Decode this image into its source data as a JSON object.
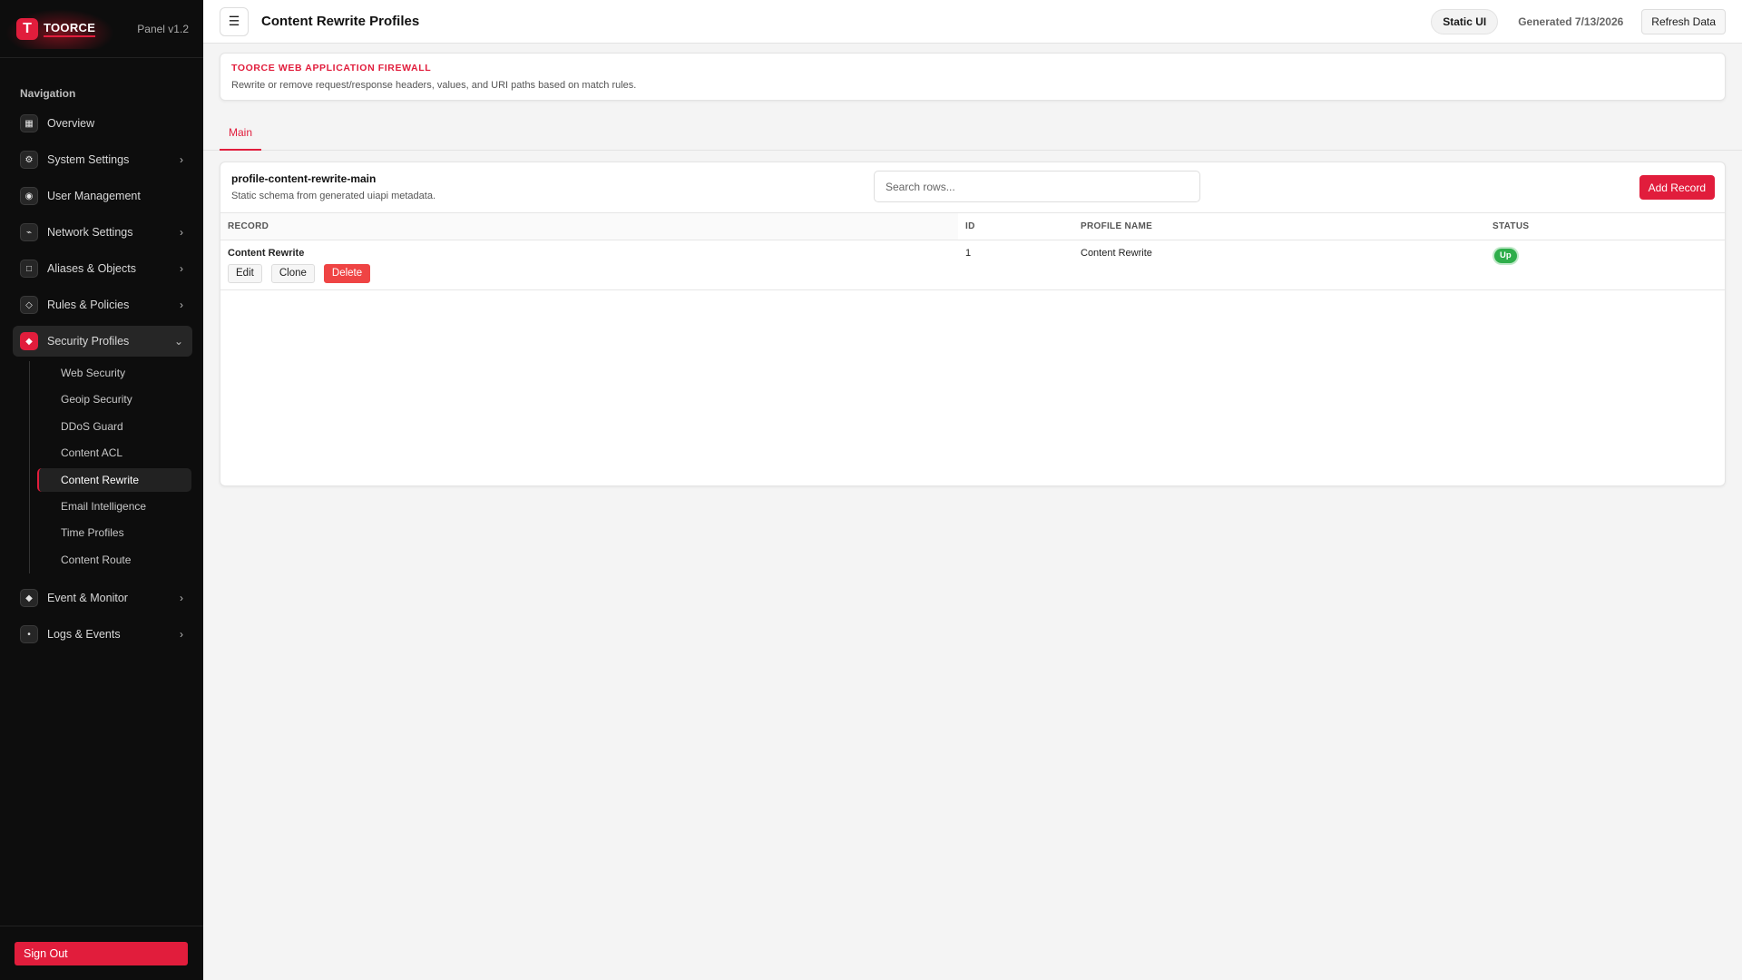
{
  "brand": {
    "name": "TOORCE",
    "logo_letter": "T",
    "version": "Panel v1.2"
  },
  "sidebar": {
    "heading": "Navigation",
    "items": [
      {
        "label": "Overview",
        "icon": "grid-icon",
        "glyph": "▦",
        "expandable": false
      },
      {
        "label": "System Settings",
        "icon": "gear-icon",
        "glyph": "⚙",
        "expandable": true
      },
      {
        "label": "User Management",
        "icon": "user-icon",
        "glyph": "◉",
        "expandable": false
      },
      {
        "label": "Network Settings",
        "icon": "network-icon",
        "glyph": "⌁",
        "expandable": true
      },
      {
        "label": "Aliases & Objects",
        "icon": "box-icon",
        "glyph": "□",
        "expandable": true
      },
      {
        "label": "Rules & Policies",
        "icon": "diamond-icon",
        "glyph": "◇",
        "expandable": true
      },
      {
        "label": "Security Profiles",
        "icon": "shield-icon",
        "glyph": "◆",
        "expandable": true,
        "open": true
      },
      {
        "label": "Event & Monitor",
        "icon": "monitor-icon",
        "glyph": "◆",
        "expandable": true
      },
      {
        "label": "Logs & Events",
        "icon": "log-icon",
        "glyph": "•",
        "expandable": true
      }
    ],
    "sub_items": [
      "Web Security",
      "Geoip Security",
      "DDoS Guard",
      "Content ACL",
      "Content Rewrite",
      "Email Intelligence",
      "Time Profiles",
      "Content Route"
    ],
    "active_sub": "Content Rewrite",
    "sign_out": "Sign Out"
  },
  "topbar": {
    "menu_glyph": "☰",
    "title": "Content Rewrite Profiles",
    "mode_pill": "Static UI",
    "generated": "Generated 7/13/2026",
    "refresh": "Refresh Data"
  },
  "banner": {
    "kicker": "TOORCE WEB APPLICATION FIREWALL",
    "description": "Rewrite or remove request/response headers, values, and URI paths based on match rules."
  },
  "tabs": [
    {
      "label": "Main",
      "active": true
    }
  ],
  "table_card": {
    "title": "profile-content-rewrite-main",
    "subtitle": "Static schema from generated uiapi metadata.",
    "search_placeholder": "Search rows...",
    "add_label": "Add Record",
    "columns": [
      "RECORD",
      "ID",
      "PROFILE NAME",
      "STATUS"
    ],
    "rows": [
      {
        "record": "Content Rewrite",
        "id": "1",
        "profile_name": "Content Rewrite",
        "status": "Up",
        "actions": {
          "edit": "Edit",
          "clone": "Clone",
          "delete": "Delete"
        }
      }
    ]
  },
  "colors": {
    "accent": "#e11d3c",
    "sidebar_bg": "#0d0d0d",
    "status_up": "#2fae4b",
    "danger": "#ef4444"
  }
}
